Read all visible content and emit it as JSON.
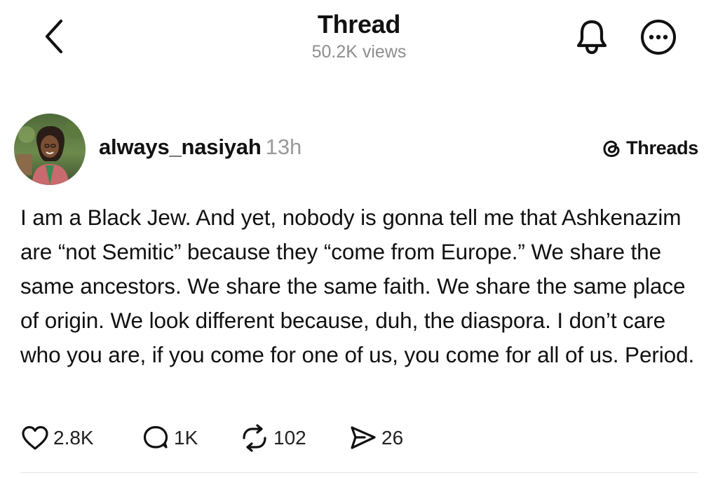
{
  "header": {
    "title": "Thread",
    "subtitle": "50.2K views",
    "back_icon": "chevron-left-icon",
    "bell_icon": "bell-icon",
    "more_icon": "more-horizontal-icon"
  },
  "post": {
    "username": "always_nasiyah",
    "timestamp": "13h",
    "source_badge": "Threads",
    "source_icon": "threads-logo-icon",
    "body": "I am a Black Jew. And yet, nobody is gonna tell me that Ashkenazim are “not Semitic” because they “come from Europe.” We share the same ancestors. We share the same faith. We share the same place of origin. We look different because, duh, the diaspora. I don’t care who you are, if you come for one of us, you come for all of us. Period.",
    "actions": {
      "likes": "2.8K",
      "replies": "1K",
      "reposts": "102",
      "shares": "26"
    }
  },
  "colors": {
    "text": "#111111",
    "muted": "#8e8e8e",
    "background": "#ffffff",
    "divider": "#e4e4e4"
  }
}
